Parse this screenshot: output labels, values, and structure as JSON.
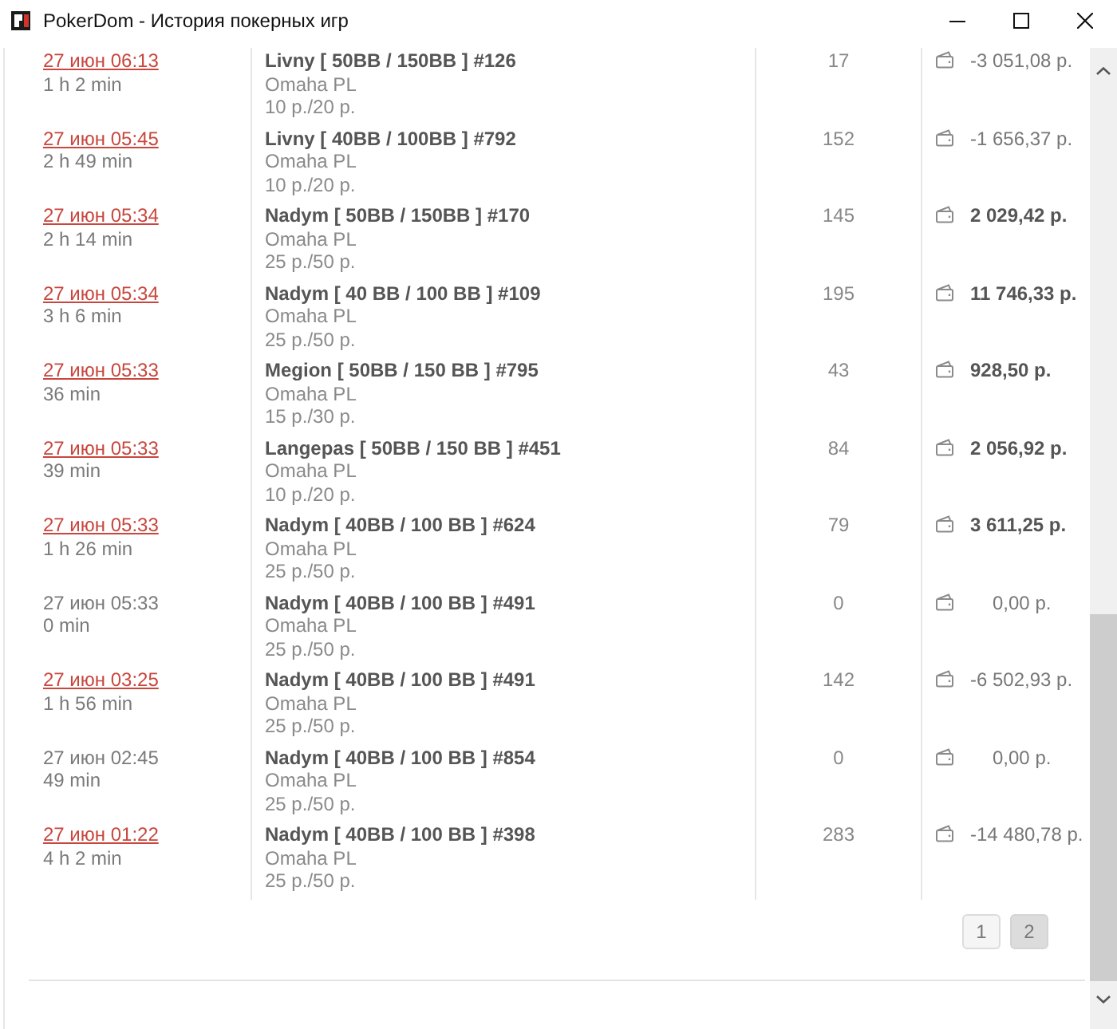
{
  "window": {
    "title": "PokerDom - История покерных игр"
  },
  "games": [
    {
      "date": "27 июн 06:13",
      "linked": true,
      "duration": "1 h 2 min",
      "table": "Livny [ 50BB / 150BB ] #126",
      "game": "Omaha PL",
      "stakes": "10 р./20 р.",
      "hands": "17",
      "result": "-3 051,08 р.",
      "kind": "loss"
    },
    {
      "date": "27 июн 05:45",
      "linked": true,
      "duration": "2 h 49 min",
      "table": "Livny [ 40BB / 100BB ] #792",
      "game": "Omaha PL",
      "stakes": "10 р./20 р.",
      "hands": "152",
      "result": "-1 656,37 р.",
      "kind": "loss"
    },
    {
      "date": "27 июн 05:34",
      "linked": true,
      "duration": "2 h 14 min",
      "table": "Nadym [ 50BB / 150BB ] #170",
      "game": "Omaha PL",
      "stakes": "25 р./50 р.",
      "hands": "145",
      "result": "2 029,42 р.",
      "kind": "win"
    },
    {
      "date": "27 июн 05:34",
      "linked": true,
      "duration": "3 h 6 min",
      "table": "Nadym [ 40 BB / 100 BB ] #109",
      "game": "Omaha PL",
      "stakes": "25 р./50 р.",
      "hands": "195",
      "result": "11 746,33 р.",
      "kind": "win"
    },
    {
      "date": "27 июн 05:33",
      "linked": true,
      "duration": "36 min",
      "table": "Megion [ 50BB / 150 BB ] #795",
      "game": "Omaha PL",
      "stakes": "15 р./30 р.",
      "hands": "43",
      "result": "928,50 р.",
      "kind": "win"
    },
    {
      "date": "27 июн 05:33",
      "linked": true,
      "duration": "39 min",
      "table": "Langepas [ 50BB / 150 BB ] #451",
      "game": "Omaha PL",
      "stakes": "10 р./20 р.",
      "hands": "84",
      "result": "2 056,92 р.",
      "kind": "win"
    },
    {
      "date": "27 июн 05:33",
      "linked": true,
      "duration": "1 h 26 min",
      "table": "Nadym [ 40BB / 100 BB ] #624",
      "game": "Omaha PL",
      "stakes": "25 р./50 р.",
      "hands": "79",
      "result": "3 611,25 р.",
      "kind": "win"
    },
    {
      "date": "27 июн 05:33",
      "linked": false,
      "duration": "0 min",
      "table": "Nadym [ 40BB / 100 BB ] #491",
      "game": "Omaha PL",
      "stakes": "25 р./50 р.",
      "hands": "0",
      "result": "0,00 р.",
      "kind": "zero"
    },
    {
      "date": "27 июн 03:25",
      "linked": true,
      "duration": "1 h 56 min",
      "table": "Nadym [ 40BB / 100 BB ] #491",
      "game": "Omaha PL",
      "stakes": "25 р./50 р.",
      "hands": "142",
      "result": "-6 502,93 р.",
      "kind": "loss"
    },
    {
      "date": "27 июн 02:45",
      "linked": false,
      "duration": "49 min",
      "table": "Nadym [ 40BB / 100 BB ] #854",
      "game": "Omaha PL",
      "stakes": "25 р./50 р.",
      "hands": "0",
      "result": "0,00 р.",
      "kind": "zero"
    },
    {
      "date": "27 июн 01:22",
      "linked": true,
      "duration": "4 h 2 min",
      "table": "Nadym [ 40BB / 100 BB ] #398",
      "game": "Omaha PL",
      "stakes": "25 р./50 р.",
      "hands": "283",
      "result": "-14 480,78 р.",
      "kind": "loss"
    }
  ],
  "pagination": [
    {
      "label": "1",
      "selected": false
    },
    {
      "label": "2",
      "selected": true
    }
  ]
}
